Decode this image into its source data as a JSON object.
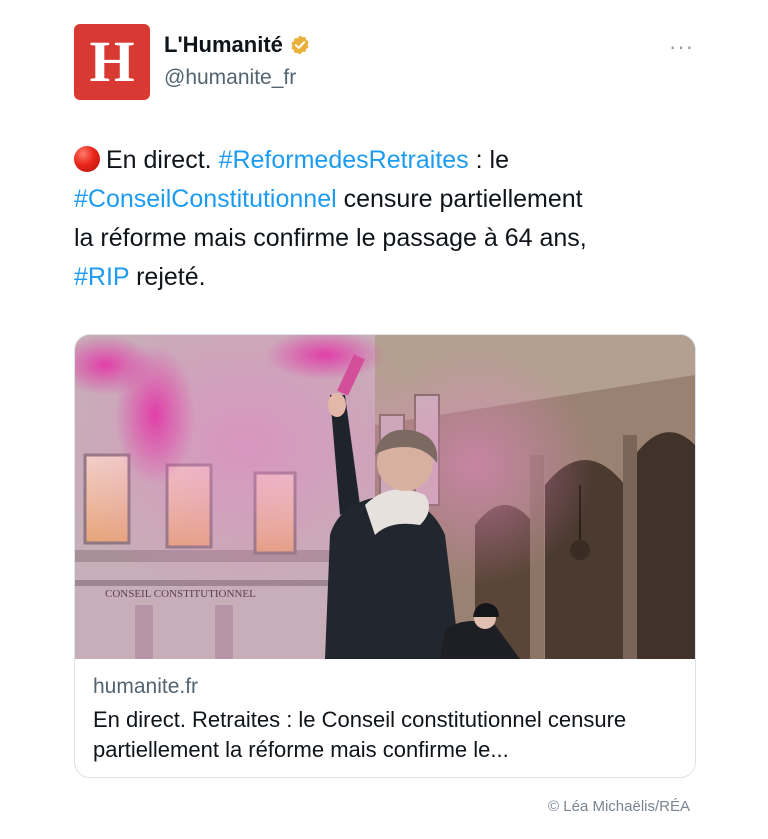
{
  "account": {
    "avatar_letter": "H",
    "display_name": "L'Humanité",
    "handle": "@humanite_fr",
    "verified": true,
    "more_menu": "···"
  },
  "tweet": {
    "lines": [
      {
        "part1": "En direct.",
        "hashtag1": "#ReformedesRetraites",
        "part2": " : le"
      },
      {
        "hashtag": "#ConseilConstitutionnel",
        "rest": " censure partiellement"
      },
      {
        "text": "la réforme mais confirme le passage à 64 ans,"
      },
      {
        "hashtag": "#RIP",
        "rest": " rejeté."
      }
    ]
  },
  "link_card": {
    "image_caption_text": "CONSEIL CONSTITUTIONNEL",
    "domain": "humanite.fr",
    "title": "En direct. Retraites : le Conseil constitutionnel censure partiellement la réforme mais confirme le..."
  },
  "credit": "© Léa Michaëlis/RÉA",
  "colors": {
    "link": "#1d9bf0",
    "avatar_bg": "#d83a33",
    "verified_badge": "#e8b23a",
    "smoke": "#e04fb0"
  }
}
